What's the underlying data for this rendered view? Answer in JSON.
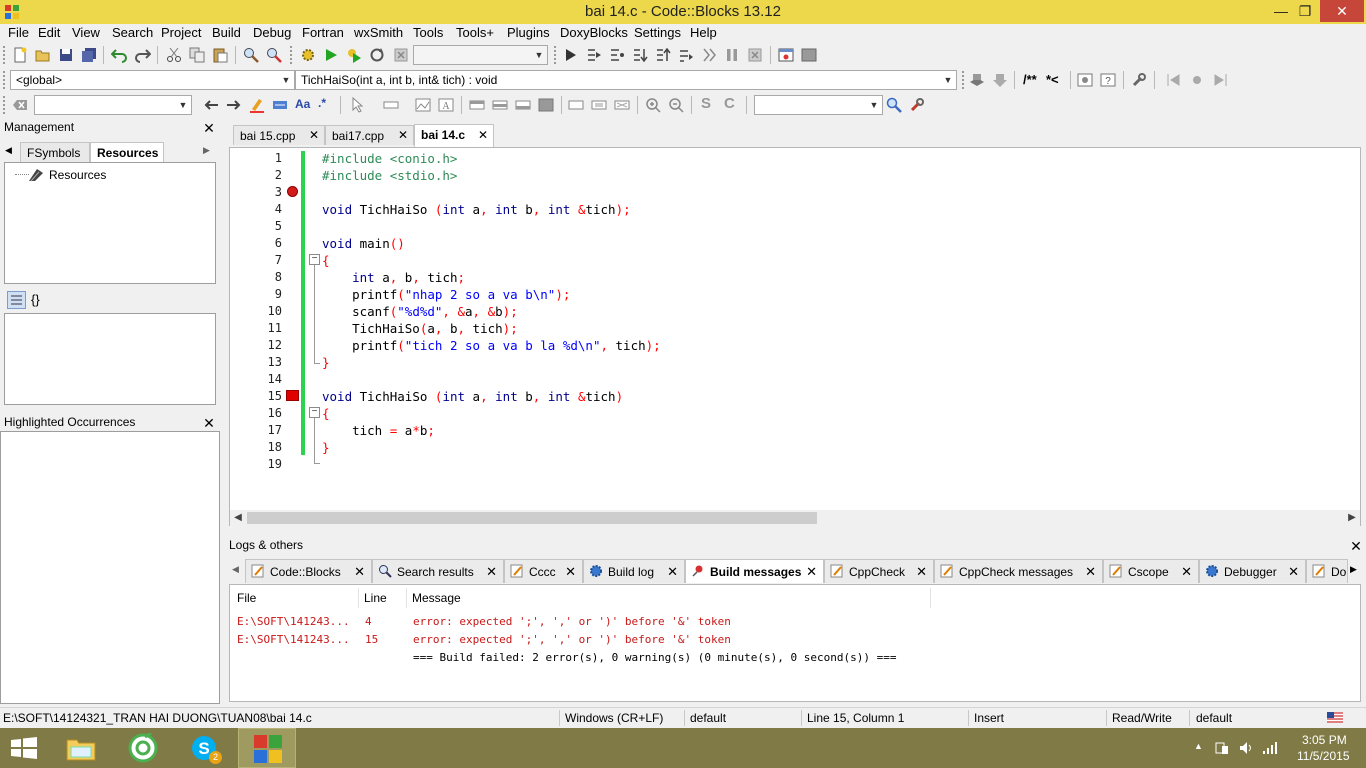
{
  "window": {
    "title": "bai 14.c - Code::Blocks 13.12",
    "min_glyph": "—",
    "max_glyph": "❐",
    "close_glyph": "✕"
  },
  "menu": [
    "File",
    "Edit",
    "View",
    "Search",
    "Project",
    "Build",
    "Debug",
    "Fortran",
    "wxSmith",
    "Tools",
    "Tools+",
    "Plugins",
    "DoxyBlocks",
    "Settings",
    "Help"
  ],
  "codebar": {
    "scope": "<global>",
    "function": "TichHaiSo(int a, int b, int& tich) : void",
    "doxy1": "/**",
    "doxy2": "*<"
  },
  "searchbar": {
    "find_value": "",
    "search_value": ""
  },
  "management": {
    "title": "Management",
    "tabs": [
      "FSymbols",
      "Resources"
    ],
    "active_tab": "Resources",
    "tree_root": "Resources",
    "braces": "{}"
  },
  "highlighted": {
    "title": "Highlighted Occurrences"
  },
  "editor": {
    "tabs": [
      {
        "label": "bai 15.cpp",
        "active": false
      },
      {
        "label": "bai17.cpp",
        "active": false
      },
      {
        "label": "bai 14.c",
        "active": true
      }
    ],
    "line_numbers": [
      "1",
      "2",
      "3",
      "4",
      "5",
      "6",
      "7",
      "8",
      "9",
      "10",
      "11",
      "12",
      "13",
      "14",
      "15",
      "16",
      "17",
      "18",
      "19"
    ],
    "breakpoint_line": 3,
    "error_line": 15
  },
  "logs": {
    "title": "Logs & others",
    "tabs": [
      "Code::Blocks",
      "Search results",
      "Cccc",
      "Build log",
      "Build messages",
      "CppCheck",
      "CppCheck messages",
      "Cscope",
      "Debugger",
      "Do"
    ],
    "active_tab": "Build messages",
    "columns": [
      "File",
      "Line",
      "Message"
    ],
    "rows": [
      {
        "file": "E:\\SOFT\\141243...",
        "line": "4",
        "message": "error: expected ';', ',' or ')' before '&' token"
      },
      {
        "file": "E:\\SOFT\\141243...",
        "line": "15",
        "message": "error: expected ';', ',' or ')' before '&' token"
      },
      {
        "file": "",
        "line": "",
        "message": "=== Build failed: 2 error(s), 0 warning(s) (0 minute(s), 0 second(s)) ==="
      }
    ]
  },
  "statusbar": {
    "path": "E:\\SOFT\\14124321_TRAN HAI DUONG\\TUAN08\\bai 14.c",
    "eol": "Windows (CR+LF)",
    "encoding": "default",
    "position": "Line 15, Column 1",
    "mode": "Insert",
    "access": "Read/Write",
    "lang": "default"
  },
  "taskbar": {
    "time": "3:05 PM",
    "date": "11/5/2015",
    "skype_badge": "2"
  },
  "colors": {
    "titlebar": "#edd84c",
    "taskbar": "#7f7a46",
    "keyword": "#00008b",
    "preprocessor": "#2e8b57",
    "string": "#0000ff",
    "operator": "#ff0000",
    "error_text": "#c81818",
    "change_bar": "#2dd34e"
  }
}
